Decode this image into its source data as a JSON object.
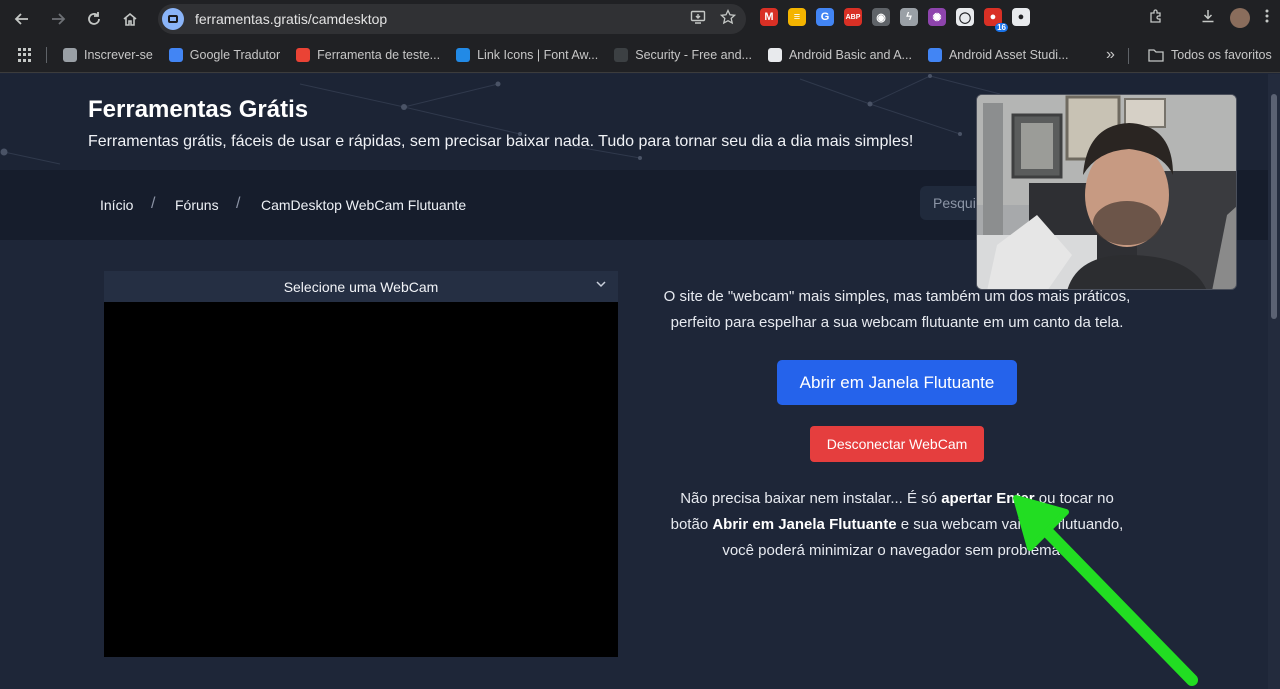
{
  "browser": {
    "url": "ferramentas.gratis/camdesktop",
    "bookmarks": [
      {
        "label": "Inscrever-se",
        "color": "#9aa0a6"
      },
      {
        "label": "Google Tradutor",
        "color": "#4285f4"
      },
      {
        "label": "Ferramenta de teste...",
        "color": "#ea4335"
      },
      {
        "label": "Link Icons | Font Aw...",
        "color": "#228ae6"
      },
      {
        "label": "Security - Free and...",
        "color": "#3c4043"
      },
      {
        "label": "Android Basic and A...",
        "color": "#e8eaed"
      },
      {
        "label": "Android Asset Studi...",
        "color": "#4285f4"
      }
    ],
    "overflow_label": "»",
    "all_favorites_label": "Todos os favoritos",
    "extensions": [
      {
        "name": "gmail-extension-icon",
        "color": "#d93025",
        "text": "M"
      },
      {
        "name": "rss-extension-icon",
        "color": "#f4b400",
        "text": "≡"
      },
      {
        "name": "translate-extension-icon",
        "color": "#4285f4",
        "text": "G"
      },
      {
        "name": "adblock-plus-icon",
        "color": "#d93025",
        "text": "ABP"
      },
      {
        "name": "eye-extension-icon",
        "color": "#5f6368",
        "text": "◉"
      },
      {
        "name": "lightning-extension-icon",
        "color": "#9aa0a6",
        "text": "ϟ"
      },
      {
        "name": "gear-extension-icon",
        "color": "#8e44ad",
        "text": "✺"
      },
      {
        "name": "circle-extension-icon",
        "color": "#e8eaed",
        "text": "◯"
      },
      {
        "name": "badge-extension-icon",
        "color": "#d93025",
        "text": "●",
        "badge": "16"
      },
      {
        "name": "chat-extension-icon",
        "color": "#e8eaed",
        "text": "●"
      }
    ]
  },
  "site": {
    "title": "Ferramentas Grátis",
    "subtitle": "Ferramentas grátis, fáceis de usar e rápidas, sem precisar baixar nada. Tudo para tornar seu dia a dia mais simples!"
  },
  "breadcrumb": {
    "items": [
      "Início",
      "Fóruns",
      "CamDesktop WebCam Flutuante"
    ],
    "separator": "/"
  },
  "search": {
    "placeholder": "Pesquisar"
  },
  "webcam_select": {
    "label": "Selecione uma WebCam"
  },
  "intro": {
    "line1": "O site de \"webcam\" mais simples, mas também um dos mais práticos,",
    "line2": "perfeito para espelhar a sua webcam flutuante em um canto da tela."
  },
  "buttons": {
    "open_floating": "Abrir em Janela Flutuante",
    "disconnect": "Desconectar WebCam"
  },
  "info": {
    "p1": "Não precisa baixar nem instalar... É só ",
    "b1": "apertar Enter",
    "p2": " ou tocar no",
    "p3": "botão ",
    "b2": "Abrir em Janela Flutuante",
    "p4": " e sua webcam vai ficar flutuando,",
    "p5": "você poderá minimizar o navegador sem problemas."
  },
  "colors": {
    "page_bg": "#1e2638",
    "primary": "#2563eb",
    "danger": "#e53e3e",
    "annotation_arrow": "#22dd22"
  }
}
